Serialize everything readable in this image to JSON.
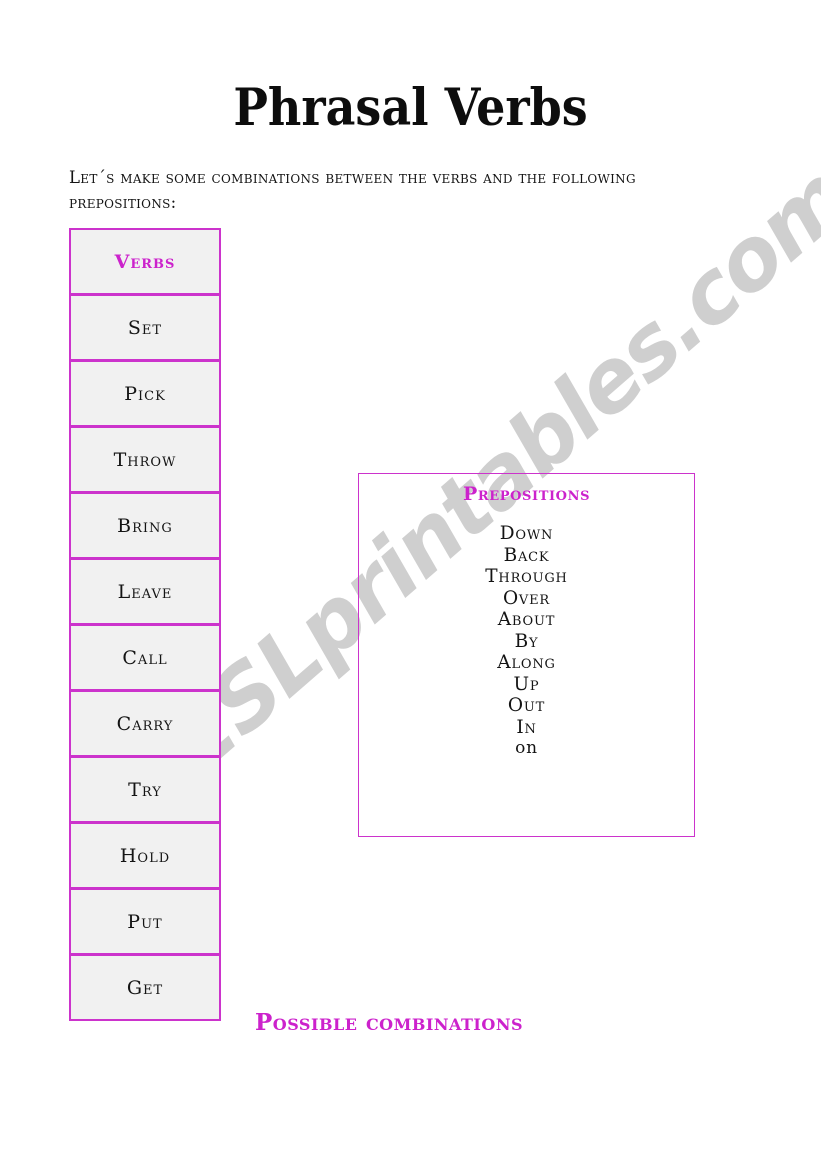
{
  "page": {
    "title": "Phrasal Verbs",
    "instructions": "Let´s make some combinations between the verbs and the following prepositions:",
    "footer_heading": "Possible combinations",
    "watermark": "ESLprintables.com",
    "accent_color": "#cc22cc",
    "border_color": "#cc33cc",
    "cell_fill_color": "#f1f1f1",
    "text_color": "#141414",
    "watermark_color": "#cfcfcf",
    "background_color": "#ffffff"
  },
  "verbs_table": {
    "header": "Verbs",
    "items": [
      {
        "label": "Set"
      },
      {
        "label": "Pick"
      },
      {
        "label": "Throw"
      },
      {
        "label": "Bring"
      },
      {
        "label": "Leave"
      },
      {
        "label": "Call"
      },
      {
        "label": "Carry"
      },
      {
        "label": "Try"
      },
      {
        "label": "Hold"
      },
      {
        "label": "Put"
      },
      {
        "label": "Get"
      }
    ]
  },
  "prepositions_box": {
    "title": "Prepositions",
    "items": [
      {
        "label": "Down",
        "lowercase": false
      },
      {
        "label": "Back",
        "lowercase": false
      },
      {
        "label": "Through",
        "lowercase": false
      },
      {
        "label": "Over",
        "lowercase": false
      },
      {
        "label": "About",
        "lowercase": false
      },
      {
        "label": "By",
        "lowercase": false
      },
      {
        "label": "Along",
        "lowercase": false
      },
      {
        "label": "Up",
        "lowercase": false
      },
      {
        "label": "Out",
        "lowercase": false
      },
      {
        "label": "In",
        "lowercase": false
      },
      {
        "label": "on",
        "lowercase": true
      }
    ]
  }
}
